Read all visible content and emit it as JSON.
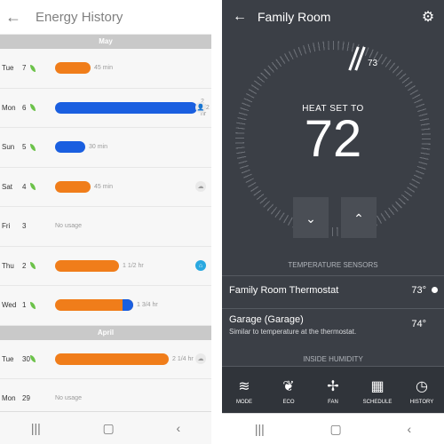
{
  "left": {
    "title": "Energy History",
    "back_icon": "arrow-left-icon",
    "months": {
      "may": "May",
      "april": "April"
    },
    "rows": [
      {
        "day": "Tue",
        "num": "7",
        "leaf": true,
        "duration": "45 min",
        "usage": 0.25,
        "icon": ""
      },
      {
        "day": "Mon",
        "num": "6",
        "leaf": true,
        "duration": "2 1/2 hr",
        "usage": 1.0,
        "icon": "person-icon"
      },
      {
        "day": "Sun",
        "num": "5",
        "leaf": true,
        "duration": "30 min",
        "usage": 0.2,
        "icon": ""
      },
      {
        "day": "Sat",
        "num": "4",
        "leaf": true,
        "duration": "45 min",
        "usage": 0.25,
        "icon": "cloud-icon"
      },
      {
        "day": "Fri",
        "num": "3",
        "leaf": false,
        "duration": "",
        "usage": 0,
        "nousage": "No usage",
        "icon": ""
      },
      {
        "day": "Thu",
        "num": "2",
        "leaf": true,
        "duration": "1 1/2 hr",
        "usage": 0.45,
        "icon": "home-icon"
      },
      {
        "day": "Wed",
        "num": "1",
        "leaf": true,
        "duration": "1 3/4 hr",
        "usage": 0.55,
        "icon": ""
      },
      {
        "day": "Tue",
        "num": "30",
        "leaf": true,
        "duration": "2 1/4 hr",
        "usage": 0.8,
        "icon": "cloud-icon"
      },
      {
        "day": "Mon",
        "num": "29",
        "leaf": false,
        "duration": "",
        "usage": 0,
        "nousage": "No usage",
        "icon": ""
      }
    ],
    "colors": {
      "heat": "#f07d1a",
      "cool": "#1a5fe0",
      "leaf": "#6cc24a"
    }
  },
  "right": {
    "title": "Family Room",
    "heat_label": "HEAT SET TO",
    "set_temp": "72",
    "current_temp": "73",
    "sensors_label": "TEMPERATURE SENSORS",
    "sensors": [
      {
        "name": "Family Room Thermostat",
        "temp": "73°",
        "sub": ""
      },
      {
        "name": "Garage (Garage)",
        "temp": "74°",
        "sub": "Similar to temperature at the thermostat."
      }
    ],
    "humidity_label": "INSIDE HUMIDITY",
    "tabs": [
      {
        "label": "MODE",
        "icon": "mode-icon"
      },
      {
        "label": "ECO",
        "icon": "leaf-icon"
      },
      {
        "label": "FAN",
        "icon": "fan-icon"
      },
      {
        "label": "SCHEDULE",
        "icon": "calendar-icon"
      },
      {
        "label": "HISTORY",
        "icon": "history-icon"
      }
    ]
  }
}
